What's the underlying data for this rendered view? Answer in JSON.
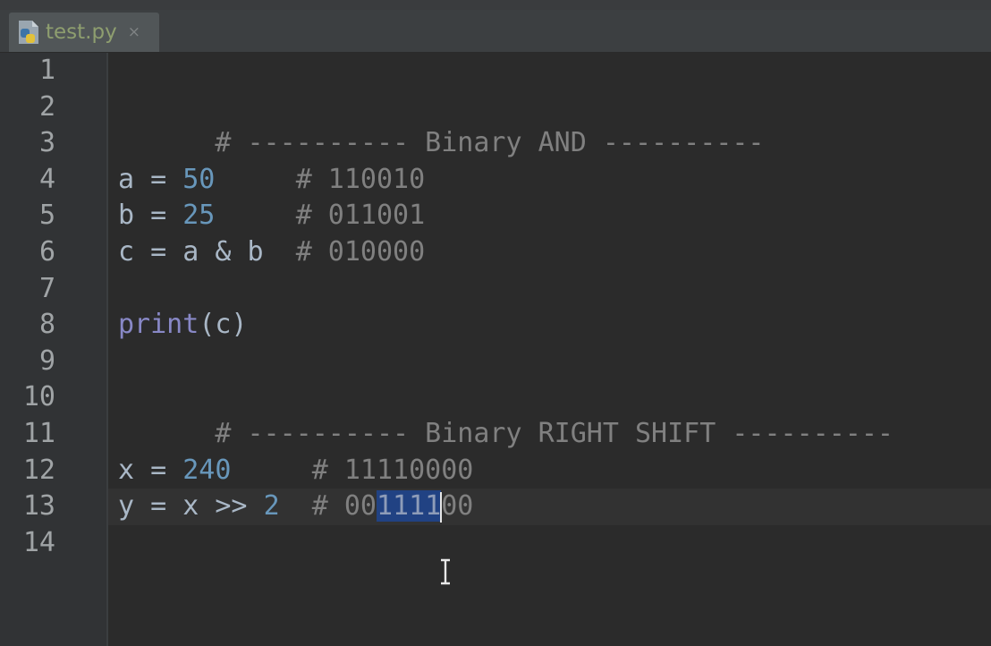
{
  "tab": {
    "label": "test.py",
    "close": "×"
  },
  "colors": {
    "background": "#2b2b2b",
    "keyword_number": "#6897bb",
    "comment": "#808080",
    "builtin": "#8888c6",
    "selection": "#214283",
    "text": "#a9b7c6"
  },
  "gutter": {
    "line_numbers": [
      "1",
      "2",
      "3",
      "4",
      "5",
      "6",
      "7",
      "8",
      "9",
      "10",
      "11",
      "12",
      "13",
      "14"
    ]
  },
  "code": {
    "l2": "# ---------- Binary AND ----------",
    "l4": {
      "a": "a",
      "op": " = ",
      "num": "50",
      "pad": "     ",
      "comment": "# 110010"
    },
    "l5": {
      "a": "b",
      "op": " = ",
      "num": "25",
      "pad": "     ",
      "comment": "# 011001"
    },
    "l6": {
      "expr": "c = a & b  ",
      "comment": "# 010000"
    },
    "l8": {
      "fn": "print",
      "args": "(c)"
    },
    "l10": "# ---------- Binary RIGHT SHIFT ----------",
    "l12": {
      "a": "x",
      "op": " = ",
      "num": "240",
      "pad": "     ",
      "comment": "# 11110000"
    },
    "l13": {
      "expr": "y = x >> ",
      "num": "2",
      "pad": "  ",
      "comment_pre": "# 00",
      "selected": "1111",
      "comment_mid": "",
      "comment_post": "00"
    }
  }
}
